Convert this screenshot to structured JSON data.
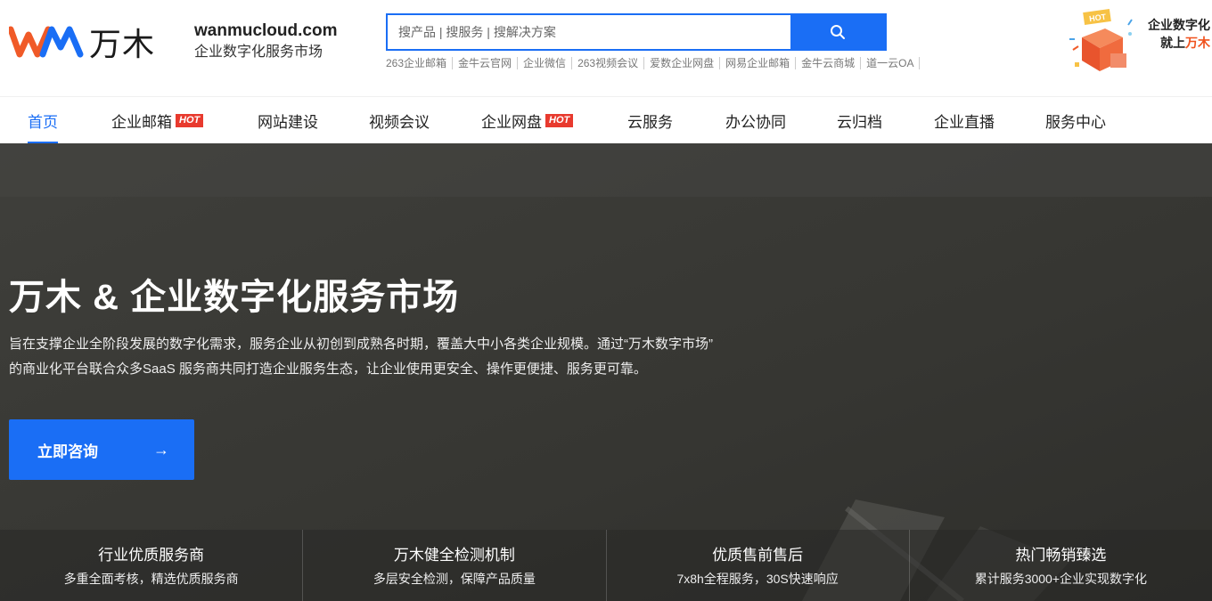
{
  "brand": {
    "logo_text": "万木",
    "domain": "wanmucloud.com",
    "tagline": "企业数字化服务市场"
  },
  "search": {
    "placeholder": "搜产品 | 搜服务 | 搜解决方案",
    "button_icon": "search-icon",
    "hot_links": [
      "263企业邮箱",
      "金牛云官网",
      "企业微信",
      "263视频会议",
      "爱数企业网盘",
      "网易企业邮箱",
      "金牛云商城",
      "道一云OA"
    ]
  },
  "promo": {
    "badge": "HOT",
    "line1": "企业数字化",
    "line2_prefix": "就上",
    "line2_accent": "万木"
  },
  "nav": {
    "items": [
      {
        "label": "首页",
        "hot": false,
        "active": true
      },
      {
        "label": "企业邮箱",
        "hot": true,
        "active": false
      },
      {
        "label": "网站建设",
        "hot": false,
        "active": false
      },
      {
        "label": "视频会议",
        "hot": false,
        "active": false
      },
      {
        "label": "企业网盘",
        "hot": true,
        "active": false
      },
      {
        "label": "云服务",
        "hot": false,
        "active": false
      },
      {
        "label": "办公协同",
        "hot": false,
        "active": false
      },
      {
        "label": "云归档",
        "hot": false,
        "active": false
      },
      {
        "label": "企业直播",
        "hot": false,
        "active": false
      },
      {
        "label": "服务中心",
        "hot": false,
        "active": false
      }
    ],
    "hot_label": "HOT"
  },
  "hero": {
    "title": "万木 & 企业数字化服务市场",
    "desc_line1": "旨在支撑企业全阶段发展的数字化需求，服务企业从初创到成熟各时期，覆盖大中小各类企业规模。通过“万木数字市场”",
    "desc_line2": "的商业化平台联合众多SaaS 服务商共同打造企业服务生态，让企业使用更安全、操作更便捷、服务更可靠。",
    "cta_label": "立即咨询",
    "cta_arrow": "→"
  },
  "features": [
    {
      "title": "行业优质服务商",
      "desc": "多重全面考核，精选优质服务商"
    },
    {
      "title": "万木健全检测机制",
      "desc": "多层安全检测，保障产品质量"
    },
    {
      "title": "优质售前售后",
      "desc": "7x8h全程服务，30S快速响应"
    },
    {
      "title": "热门畅销臻选",
      "desc": "累计服务3000+企业实现数字化"
    }
  ],
  "colors": {
    "accent": "#1a6ef5",
    "hot": "#e83a2e",
    "promo_accent": "#f0521e",
    "hero_bg": "#3a3a36"
  }
}
